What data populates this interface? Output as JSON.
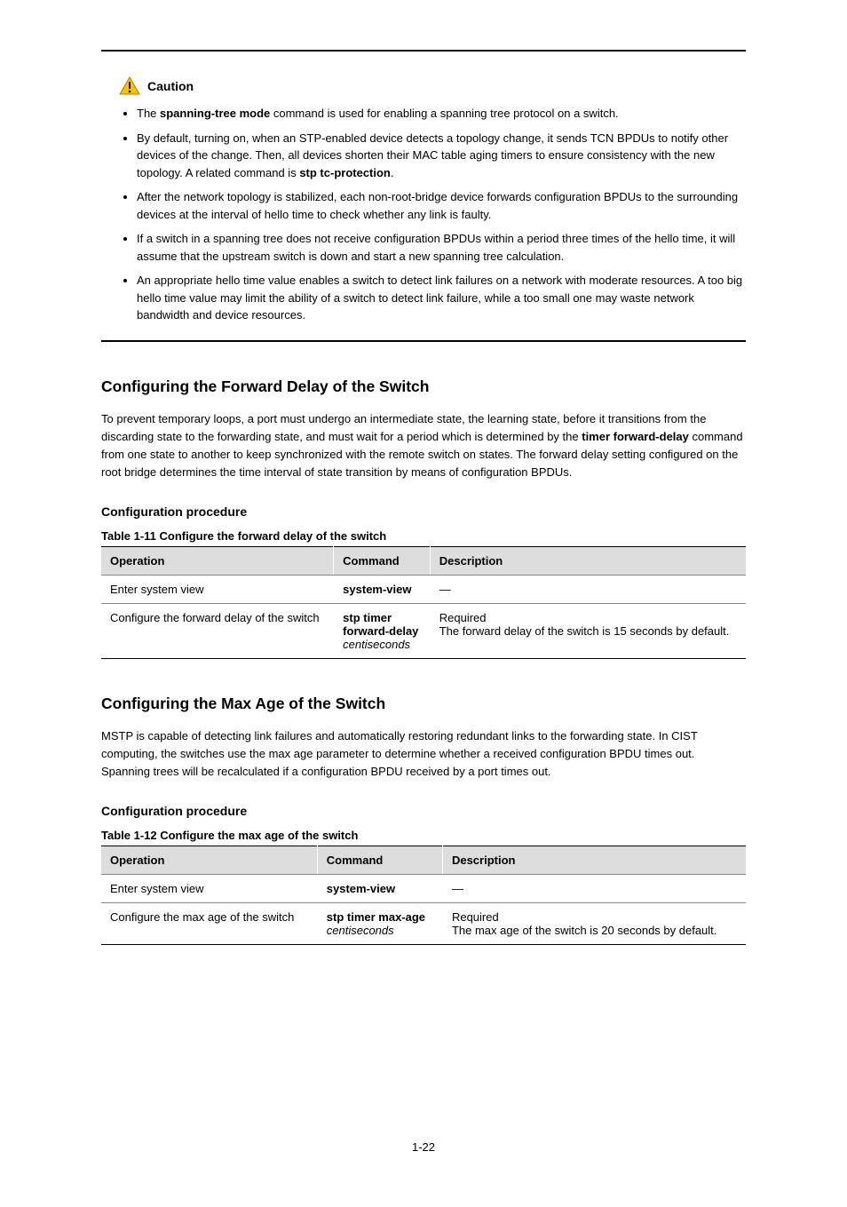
{
  "caution": {
    "label": "Caution",
    "items": [
      "The <b>spanning-tree mode</b> command is used for enabling a spanning tree protocol on a switch.",
      "By default, turning on, when an STP-enabled device detects a topology change, it sends TCN BPDUs to notify other devices of the change. Then, all devices shorten their MAC table aging timers to ensure consistency with the new topology. A related command is <b>stp tc-protection</b>.",
      "After the network topology is stabilized, each non-root-bridge device forwards configuration BPDUs to the surrounding devices at the interval of hello time to check whether any link is faulty.",
      "If a switch in a spanning tree does not receive configuration BPDUs within a period three times of the hello time, it will assume that the upstream switch is down and start a new spanning tree calculation.",
      "An appropriate hello time value enables a switch to detect link failures on a network with moderate resources. A too big hello time value may limit the ability of a switch to detect link failure, while a too small one may waste network bandwidth and device resources."
    ]
  },
  "section1": {
    "heading": "Configuring the Forward Delay of the Switch",
    "para": "To prevent temporary loops, a port must undergo an intermediate state, the learning state, before it transitions from the discarding state to the forwarding state, and must wait for a period which is determined by the <b>timer forward-delay</b> command from one state to another to keep synchronized with the remote switch on states. The forward delay setting configured on the root bridge determines the time interval of state transition by means of configuration BPDUs."
  },
  "table1": {
    "caption": "Table 1-11 Configure the forward delay of the switch",
    "headers": [
      "Operation",
      "Command",
      "Description"
    ],
    "rows": [
      {
        "op": "Enter system view",
        "cmd": "<b>system-view</b>",
        "desc": "—"
      },
      {
        "op": "Configure the forward delay of the switch",
        "cmd": "<b>stp timer<br/>forward-delay</b><br/><i>centiseconds</i>",
        "desc": "Required<br/>The forward delay of the switch is 15 seconds by default."
      }
    ]
  },
  "section2": {
    "heading": "Configuring the Max Age of the Switch",
    "para": "MSTP is capable of detecting link failures and automatically restoring redundant links to the forwarding state. In CIST computing, the switches use the max age parameter to determine whether a received configuration BPDU times out. Spanning trees will be recalculated if a configuration BPDU received by a port times out."
  },
  "table2": {
    "caption": "Table 1-12 Configure the max age of the switch",
    "headers": [
      "Operation",
      "Command",
      "Description"
    ],
    "rows": [
      {
        "op": "Enter system view",
        "cmd": "<b>system-view</b>",
        "desc": "—"
      },
      {
        "op": "Configure the max age of the switch",
        "cmd": "<b>stp timer max-age</b><br/><i>centiseconds</i>",
        "desc": "Required<br/>The max age of the switch is 20 seconds by default."
      }
    ]
  },
  "pagefoot": "1-22"
}
